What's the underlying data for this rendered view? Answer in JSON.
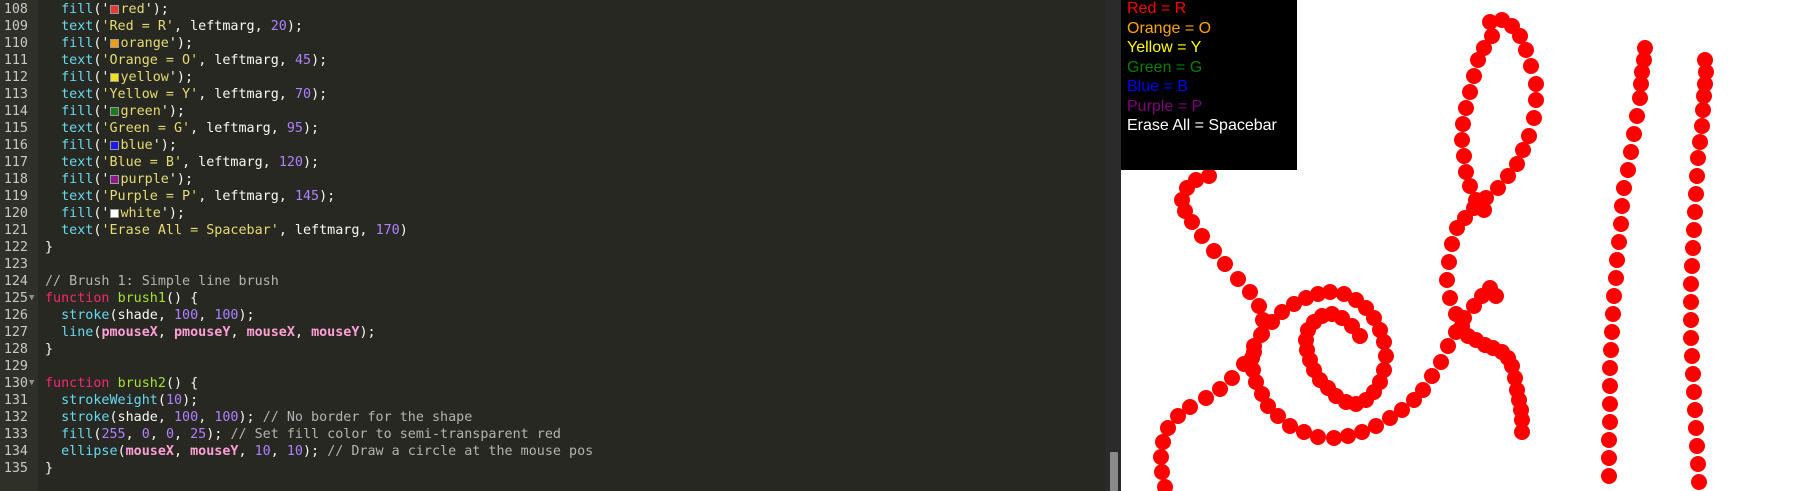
{
  "editor": {
    "first_line": 108,
    "lines": [
      {
        "num": "108",
        "tokens": [
          {
            "t": "  "
          },
          {
            "t": "fill",
            "c": "fn"
          },
          {
            "t": "('"
          },
          {
            "sw": "#e53935"
          },
          {
            "t": "red",
            "c": "str"
          },
          {
            "t": "');"
          }
        ]
      },
      {
        "num": "109",
        "tokens": [
          {
            "t": "  "
          },
          {
            "t": "text",
            "c": "fn"
          },
          {
            "t": "("
          },
          {
            "t": "'Red = R'",
            "c": "str"
          },
          {
            "t": ", leftmarg, "
          },
          {
            "t": "20",
            "c": "num"
          },
          {
            "t": ");"
          }
        ]
      },
      {
        "num": "110",
        "tokens": [
          {
            "t": "  "
          },
          {
            "t": "fill",
            "c": "fn"
          },
          {
            "t": "('"
          },
          {
            "sw": "#f29c11"
          },
          {
            "t": "orange",
            "c": "str"
          },
          {
            "t": "');"
          }
        ]
      },
      {
        "num": "111",
        "tokens": [
          {
            "t": "  "
          },
          {
            "t": "text",
            "c": "fn"
          },
          {
            "t": "("
          },
          {
            "t": "'Orange = O'",
            "c": "str"
          },
          {
            "t": ", leftmarg, "
          },
          {
            "t": "45",
            "c": "num"
          },
          {
            "t": ");"
          }
        ]
      },
      {
        "num": "112",
        "tokens": [
          {
            "t": "  "
          },
          {
            "t": "fill",
            "c": "fn"
          },
          {
            "t": "('"
          },
          {
            "sw": "#f5e216"
          },
          {
            "t": "yellow",
            "c": "str"
          },
          {
            "t": "');"
          }
        ]
      },
      {
        "num": "113",
        "tokens": [
          {
            "t": "  "
          },
          {
            "t": "text",
            "c": "fn"
          },
          {
            "t": "("
          },
          {
            "t": "'Yellow = Y'",
            "c": "str"
          },
          {
            "t": ", leftmarg, "
          },
          {
            "t": "70",
            "c": "num"
          },
          {
            "t": ");"
          }
        ]
      },
      {
        "num": "114",
        "tokens": [
          {
            "t": "  "
          },
          {
            "t": "fill",
            "c": "fn"
          },
          {
            "t": "('"
          },
          {
            "sw": "#1d7a1d"
          },
          {
            "t": "green",
            "c": "str"
          },
          {
            "t": "');"
          }
        ]
      },
      {
        "num": "115",
        "tokens": [
          {
            "t": "  "
          },
          {
            "t": "text",
            "c": "fn"
          },
          {
            "t": "("
          },
          {
            "t": "'Green = G'",
            "c": "str"
          },
          {
            "t": ", leftmarg, "
          },
          {
            "t": "95",
            "c": "num"
          },
          {
            "t": ");"
          }
        ]
      },
      {
        "num": "116",
        "tokens": [
          {
            "t": "  "
          },
          {
            "t": "fill",
            "c": "fn"
          },
          {
            "t": "('"
          },
          {
            "sw": "#1a1ae6"
          },
          {
            "t": "blue",
            "c": "str"
          },
          {
            "t": "');"
          }
        ]
      },
      {
        "num": "117",
        "tokens": [
          {
            "t": "  "
          },
          {
            "t": "text",
            "c": "fn"
          },
          {
            "t": "("
          },
          {
            "t": "'Blue = B'",
            "c": "str"
          },
          {
            "t": ", leftmarg, "
          },
          {
            "t": "120",
            "c": "num"
          },
          {
            "t": ");"
          }
        ]
      },
      {
        "num": "118",
        "tokens": [
          {
            "t": "  "
          },
          {
            "t": "fill",
            "c": "fn"
          },
          {
            "t": "('"
          },
          {
            "sw": "#8e1a8e"
          },
          {
            "t": "purple",
            "c": "str"
          },
          {
            "t": "');"
          }
        ]
      },
      {
        "num": "119",
        "tokens": [
          {
            "t": "  "
          },
          {
            "t": "text",
            "c": "fn"
          },
          {
            "t": "("
          },
          {
            "t": "'Purple = P'",
            "c": "str"
          },
          {
            "t": ", leftmarg, "
          },
          {
            "t": "145",
            "c": "num"
          },
          {
            "t": ");"
          }
        ]
      },
      {
        "num": "120",
        "tokens": [
          {
            "t": "  "
          },
          {
            "t": "fill",
            "c": "fn"
          },
          {
            "t": "('"
          },
          {
            "sw": "#ffffff"
          },
          {
            "t": "white",
            "c": "str"
          },
          {
            "t": "');"
          }
        ]
      },
      {
        "num": "121",
        "tokens": [
          {
            "t": "  "
          },
          {
            "t": "text",
            "c": "fn"
          },
          {
            "t": "("
          },
          {
            "t": "'Erase All = Spacebar'",
            "c": "str"
          },
          {
            "t": ", leftmarg, "
          },
          {
            "t": "170",
            "c": "num"
          },
          {
            "t": ")"
          }
        ]
      },
      {
        "num": "122",
        "tokens": [
          {
            "t": "}"
          }
        ]
      },
      {
        "num": "123",
        "tokens": []
      },
      {
        "num": "124",
        "tokens": [
          {
            "t": "// Brush 1: Simple line brush",
            "c": "cm"
          }
        ]
      },
      {
        "num": "125",
        "fold": true,
        "tokens": [
          {
            "t": "function",
            "c": "kw"
          },
          {
            "t": " "
          },
          {
            "t": "brush1",
            "c": "def"
          },
          {
            "t": "() {"
          }
        ]
      },
      {
        "num": "126",
        "tokens": [
          {
            "t": "  "
          },
          {
            "t": "stroke",
            "c": "fn"
          },
          {
            "t": "(shade, "
          },
          {
            "t": "100",
            "c": "num"
          },
          {
            "t": ", "
          },
          {
            "t": "100",
            "c": "num"
          },
          {
            "t": ");"
          }
        ]
      },
      {
        "num": "127",
        "tokens": [
          {
            "t": "  "
          },
          {
            "t": "line",
            "c": "fn"
          },
          {
            "t": "("
          },
          {
            "t": "pmouseX",
            "c": "var"
          },
          {
            "t": ", "
          },
          {
            "t": "pmouseY",
            "c": "var"
          },
          {
            "t": ", "
          },
          {
            "t": "mouseX",
            "c": "var"
          },
          {
            "t": ", "
          },
          {
            "t": "mouseY",
            "c": "var"
          },
          {
            "t": ");"
          }
        ]
      },
      {
        "num": "128",
        "tokens": [
          {
            "t": "}"
          }
        ]
      },
      {
        "num": "129",
        "tokens": []
      },
      {
        "num": "130",
        "fold": true,
        "tokens": [
          {
            "t": "function",
            "c": "kw"
          },
          {
            "t": " "
          },
          {
            "t": "brush2",
            "c": "def"
          },
          {
            "t": "() {"
          }
        ]
      },
      {
        "num": "131",
        "tokens": [
          {
            "t": "  "
          },
          {
            "t": "strokeWeight",
            "c": "fn"
          },
          {
            "t": "("
          },
          {
            "t": "10",
            "c": "num"
          },
          {
            "t": ");"
          }
        ]
      },
      {
        "num": "132",
        "tokens": [
          {
            "t": "  "
          },
          {
            "t": "stroke",
            "c": "fn"
          },
          {
            "t": "(shade, "
          },
          {
            "t": "100",
            "c": "num"
          },
          {
            "t": ", "
          },
          {
            "t": "100",
            "c": "num"
          },
          {
            "t": "); "
          },
          {
            "t": "// No border for the shape",
            "c": "cm"
          }
        ]
      },
      {
        "num": "133",
        "tokens": [
          {
            "t": "  "
          },
          {
            "t": "fill",
            "c": "fn"
          },
          {
            "t": "("
          },
          {
            "t": "255",
            "c": "num"
          },
          {
            "t": ", "
          },
          {
            "t": "0",
            "c": "num"
          },
          {
            "t": ", "
          },
          {
            "t": "0",
            "c": "num"
          },
          {
            "t": ", "
          },
          {
            "t": "25",
            "c": "num"
          },
          {
            "t": "); "
          },
          {
            "t": "// Set fill color to semi-transparent red",
            "c": "cm"
          }
        ]
      },
      {
        "num": "134",
        "tokens": [
          {
            "t": "  "
          },
          {
            "t": "ellipse",
            "c": "fn"
          },
          {
            "t": "("
          },
          {
            "t": "mouseX",
            "c": "var"
          },
          {
            "t": ", "
          },
          {
            "t": "mouseY",
            "c": "var"
          },
          {
            "t": ", "
          },
          {
            "t": "10",
            "c": "num"
          },
          {
            "t": ", "
          },
          {
            "t": "10",
            "c": "num"
          },
          {
            "t": "); "
          },
          {
            "t": "// Draw a circle at the mouse pos",
            "c": "cm"
          }
        ]
      },
      {
        "num": "135",
        "tokens": [
          {
            "t": "}"
          }
        ]
      }
    ]
  },
  "legend": {
    "items": [
      {
        "label": "Red = R",
        "color": "#ff0000"
      },
      {
        "label": "Orange = O",
        "color": "#ffa500"
      },
      {
        "label": "Yellow = Y",
        "color": "#ffff00"
      },
      {
        "label": "Green = G",
        "color": "#008000"
      },
      {
        "label": "Blue = B",
        "color": "#0000ff"
      },
      {
        "label": "Purple = P",
        "color": "#800080"
      },
      {
        "label": "Erase All = Spacebar",
        "color": "#ffffff"
      }
    ]
  },
  "paint": {
    "dot_color": "#ff0000"
  }
}
